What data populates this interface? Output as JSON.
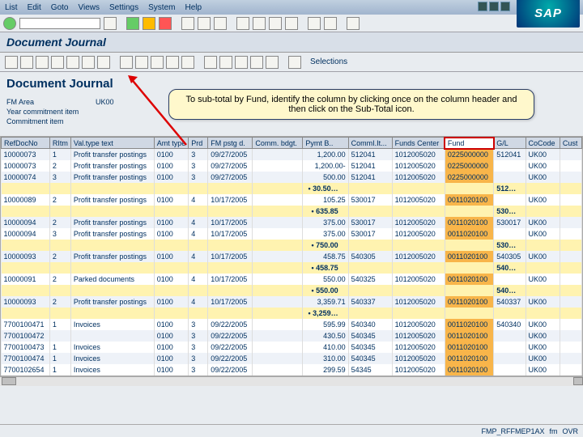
{
  "menu": {
    "items": [
      "List",
      "Edit",
      "Goto",
      "Views",
      "Settings",
      "System",
      "Help"
    ]
  },
  "logo": "SAP",
  "screen_title": "Document Journal",
  "app_toolbar": {
    "selections_label": "Selections"
  },
  "panel": {
    "title": "Document Journal",
    "fm_area_label": "FM Area",
    "fm_area_val": "UK00",
    "yci_label": "Year commitment item",
    "ci_label": "Commitment item"
  },
  "callout": "To sub-total by Fund, identify the column by clicking once on the column header and then click on the Sub-Total icon.",
  "columns": [
    "RefDocNo",
    "RItm",
    "Val.type text",
    "Amt type",
    "Prd",
    "FM pstg d.",
    "Comm. bdgt.",
    "Pymt B..",
    "CommI.It...",
    "Funds Center",
    "Fund",
    "G/L",
    "CoCode",
    "Cust"
  ],
  "rows": [
    {
      "t": "d",
      "c": [
        "10000073",
        "1",
        "Profit transfer postings",
        "0100",
        "3",
        "09/27/2005",
        "",
        "1,200.00",
        "512041",
        "1012005020",
        "0225000000",
        "512041",
        "UK00",
        ""
      ]
    },
    {
      "t": "d",
      "c": [
        "10000073",
        "2",
        "Profit transfer postings",
        "0100",
        "3",
        "09/27/2005",
        "",
        "1,200.00-",
        "512041",
        "1012005020",
        "0225000000",
        "",
        "UK00",
        ""
      ]
    },
    {
      "t": "d",
      "c": [
        "10000074",
        "3",
        "Profit transfer postings",
        "0100",
        "3",
        "09/27/2005",
        "",
        "500.00",
        "512041",
        "1012005020",
        "0225000000",
        "",
        "UK00",
        ""
      ]
    },
    {
      "t": "s",
      "lbl": "30.50…",
      "gl": "512…"
    },
    {
      "t": "d",
      "c": [
        "10000089",
        "2",
        "Profit transfer postings",
        "0100",
        "4",
        "10/17/2005",
        "",
        "105.25",
        "530017",
        "1012005020",
        "0011020100",
        "",
        "UK00",
        ""
      ]
    },
    {
      "t": "s",
      "lbl": "635.85",
      "gl": "530…"
    },
    {
      "t": "d",
      "c": [
        "10000094",
        "2",
        "Profit transfer postings",
        "0100",
        "4",
        "10/17/2005",
        "",
        "375.00",
        "530017",
        "1012005020",
        "0011020100",
        "530017",
        "UK00",
        ""
      ]
    },
    {
      "t": "d",
      "c": [
        "10000094",
        "3",
        "Profit transfer postings",
        "0100",
        "4",
        "10/17/2005",
        "",
        "375.00",
        "530017",
        "1012005020",
        "0011020100",
        "",
        "UK00",
        ""
      ]
    },
    {
      "t": "s",
      "lbl": "750.00",
      "gl": "530…"
    },
    {
      "t": "d",
      "c": [
        "10000093",
        "2",
        "Profit transfer postings",
        "0100",
        "4",
        "10/17/2005",
        "",
        "458.75",
        "540305",
        "1012005020",
        "0011020100",
        "540305",
        "UK00",
        ""
      ]
    },
    {
      "t": "s",
      "lbl": "458.75",
      "gl": "540…"
    },
    {
      "t": "d",
      "c": [
        "10000091",
        "2",
        "Parked documents",
        "0100",
        "4",
        "10/17/2005",
        "",
        "550.00",
        "540325",
        "1012005020",
        "0011020100",
        "",
        "UK00",
        ""
      ]
    },
    {
      "t": "s",
      "lbl": "550.00",
      "gl": "540…"
    },
    {
      "t": "d",
      "c": [
        "10000093",
        "2",
        "Profit transfer postings",
        "0100",
        "4",
        "10/17/2005",
        "",
        "3,359.71",
        "540337",
        "1012005020",
        "0011020100",
        "540337",
        "UK00",
        ""
      ]
    },
    {
      "t": "s",
      "lbl": "3,259…",
      "gl": ""
    },
    {
      "t": "d",
      "c": [
        "7700100471",
        "1",
        "Invoices",
        "0100",
        "3",
        "09/22/2005",
        "",
        "595.99",
        "540340",
        "1012005020",
        "0011020100",
        "540340",
        "UK00",
        ""
      ]
    },
    {
      "t": "d",
      "c": [
        "7700100472",
        "",
        "",
        "0100",
        "3",
        "09/22/2005",
        "",
        "430.50",
        "540345",
        "1012005020",
        "0011020100",
        "",
        "UK00",
        ""
      ]
    },
    {
      "t": "d",
      "c": [
        "7700100473",
        "1",
        "Invoices",
        "0100",
        "3",
        "09/22/2005",
        "",
        "410.00",
        "540345",
        "1012005020",
        "0011020100",
        "",
        "UK00",
        ""
      ]
    },
    {
      "t": "d",
      "c": [
        "7700100474",
        "1",
        "Invoices",
        "0100",
        "3",
        "09/22/2005",
        "",
        "310.00",
        "540345",
        "1012005020",
        "0011020100",
        "",
        "UK00",
        ""
      ]
    },
    {
      "t": "d",
      "c": [
        "7700102654",
        "1",
        "Invoices",
        "0100",
        "3",
        "09/22/2005",
        "",
        "299.59",
        "54345",
        "1012005020",
        "0011020100",
        "",
        "UK00",
        ""
      ]
    }
  ],
  "status": {
    "sess": "FMP_RFFMEP1AX",
    "client": "fm",
    "ovr": "OVR"
  }
}
